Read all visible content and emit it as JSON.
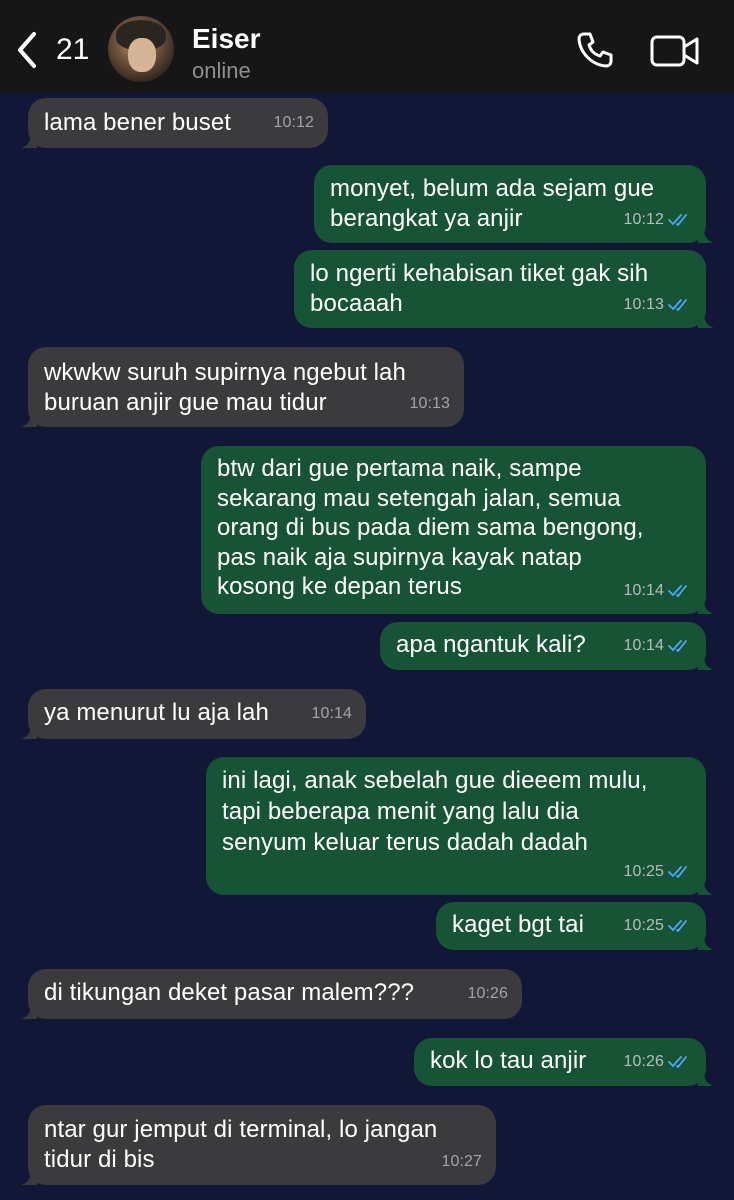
{
  "header": {
    "back_count": "21",
    "contact_name": "Eiser",
    "contact_status": "online"
  },
  "messages": [
    {
      "dir": "in",
      "text": "lama bener buset",
      "time": "10:12"
    },
    {
      "dir": "out",
      "text": "monyet, belum ada sejam gue\nberangkat ya anjir",
      "time": "10:12"
    },
    {
      "dir": "out",
      "text": "lo ngerti kehabisan tiket gak sih\nbocaaah",
      "time": "10:13"
    },
    {
      "dir": "in",
      "text": "wkwkw suruh supirnya ngebut lah\nburuan anjir gue mau tidur",
      "time": "10:13"
    },
    {
      "dir": "out",
      "text": "btw dari gue pertama naik, sampe\nsekarang mau setengah jalan, semua\norang di bus pada diem sama bengong,\npas naik aja supirnya kayak natap\nkosong ke depan terus",
      "time": "10:14"
    },
    {
      "dir": "out",
      "text": "apa ngantuk kali?",
      "time": "10:14"
    },
    {
      "dir": "in",
      "text": "ya menurut lu aja lah",
      "time": "10:14"
    },
    {
      "dir": "out",
      "text": "ini lagi, anak sebelah gue dieeem mulu,\ntapi beberapa menit yang lalu dia\nsenyum keluar terus dadah dadah",
      "time": "10:25"
    },
    {
      "dir": "out",
      "text": "kaget bgt tai",
      "time": "10:25"
    },
    {
      "dir": "in",
      "text": "di tikungan deket pasar malem???",
      "time": "10:26"
    },
    {
      "dir": "out",
      "text": "kok lo tau anjir",
      "time": "10:26"
    },
    {
      "dir": "in",
      "text": "ntar gur jemput di terminal, lo jangan\ntidur di bis",
      "time": "10:27"
    }
  ],
  "colors": {
    "chat_background": "#121737",
    "incoming_bubble": "#3b3b3d",
    "outgoing_bubble": "#175435",
    "read_tick": "#4da6ff"
  },
  "icons": [
    "chevron-left-icon",
    "phone-icon",
    "video-camera-icon",
    "double-check-icon"
  ]
}
